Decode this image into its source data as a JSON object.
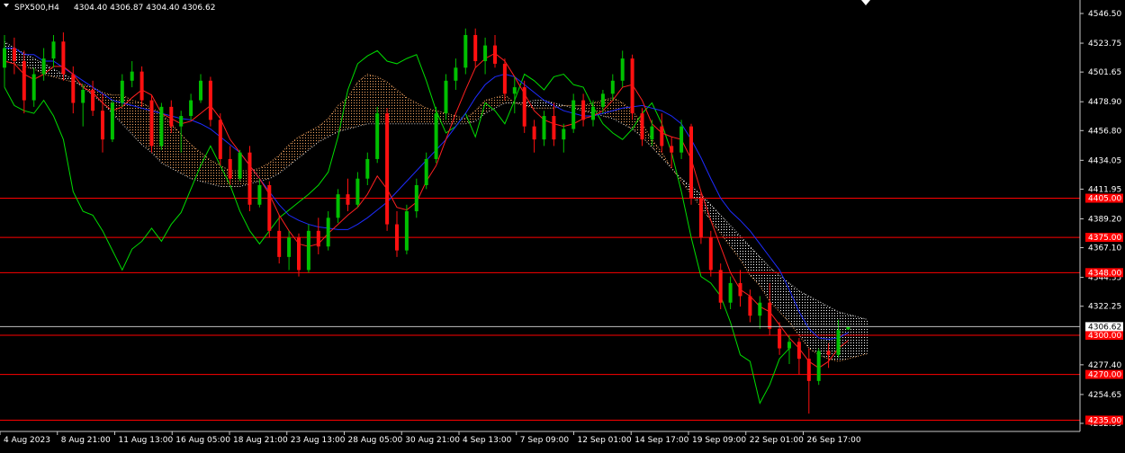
{
  "chart_data": {
    "type": "candlestick",
    "symbol_label": "SPX500,H4",
    "ohlc_label": "4304.40 4306.87 4304.40 4306.62",
    "current_price": 4306.62,
    "current_price_label": "4306.62",
    "y_ticks": [
      {
        "value": 4546.5,
        "label": "4546.50"
      },
      {
        "value": 4523.75,
        "label": "4523.75"
      },
      {
        "value": 4501.65,
        "label": "4501.65"
      },
      {
        "value": 4478.9,
        "label": "4478.90"
      },
      {
        "value": 4456.8,
        "label": "4456.80"
      },
      {
        "value": 4434.05,
        "label": "4434.05"
      },
      {
        "value": 4411.95,
        "label": "4411.95"
      },
      {
        "value": 4389.2,
        "label": "4389.20"
      },
      {
        "value": 4367.1,
        "label": "4367.10"
      },
      {
        "value": 4344.35,
        "label": "4344.35"
      },
      {
        "value": 4322.25,
        "label": "4322.25"
      },
      {
        "value": 4277.4,
        "label": "4277.40"
      },
      {
        "value": 4254.65,
        "label": "4254.65"
      },
      {
        "value": 4232.55,
        "label": "4232.55"
      }
    ],
    "x_ticks": [
      "4 Aug 2023",
      "8 Aug 21:00",
      "11 Aug 13:00",
      "16 Aug 05:00",
      "18 Aug 21:00",
      "23 Aug 13:00",
      "28 Aug 05:00",
      "30 Aug 21:00",
      "4 Sep 13:00",
      "7 Sep 09:00",
      "12 Sep 01:00",
      "14 Sep 17:00",
      "19 Sep 09:00",
      "22 Sep 01:00",
      "26 Sep 17:00"
    ],
    "levels": [
      {
        "value": 4405,
        "label": "4405.00"
      },
      {
        "value": 4375,
        "label": "4375.00"
      },
      {
        "value": 4348,
        "label": "4348.00"
      },
      {
        "value": 4300,
        "label": "4300.00"
      },
      {
        "value": 4270,
        "label": "4270.00"
      },
      {
        "value": 4235,
        "label": "4235.00"
      }
    ],
    "candles": [
      [
        4505,
        4530,
        4490,
        4520
      ],
      [
        4520,
        4528,
        4500,
        4510
      ],
      [
        4510,
        4518,
        4470,
        4480
      ],
      [
        4480,
        4505,
        4475,
        4500
      ],
      [
        4500,
        4520,
        4495,
        4512
      ],
      [
        4512,
        4530,
        4505,
        4525
      ],
      [
        4525,
        4532,
        4495,
        4500
      ],
      [
        4500,
        4506,
        4470,
        4478
      ],
      [
        4478,
        4492,
        4460,
        4488
      ],
      [
        4488,
        4495,
        4468,
        4472
      ],
      [
        4472,
        4485,
        4440,
        4450
      ],
      [
        4450,
        4480,
        4448,
        4478
      ],
      [
        4478,
        4500,
        4475,
        4495
      ],
      [
        4495,
        4510,
        4490,
        4502
      ],
      [
        4502,
        4506,
        4475,
        4480
      ],
      [
        4480,
        4484,
        4440,
        4445
      ],
      [
        4445,
        4478,
        4442,
        4475
      ],
      [
        4475,
        4480,
        4455,
        4460
      ],
      [
        4460,
        4472,
        4440,
        4468
      ],
      [
        4468,
        4485,
        4465,
        4480
      ],
      [
        4480,
        4500,
        4478,
        4495
      ],
      [
        4495,
        4498,
        4460,
        4465
      ],
      [
        4465,
        4470,
        4430,
        4435
      ],
      [
        4435,
        4445,
        4415,
        4420
      ],
      [
        4420,
        4442,
        4418,
        4440
      ],
      [
        4440,
        4445,
        4395,
        4400
      ],
      [
        4400,
        4420,
        4398,
        4415
      ],
      [
        4415,
        4418,
        4375,
        4380
      ],
      [
        4380,
        4392,
        4355,
        4360
      ],
      [
        4360,
        4380,
        4350,
        4375
      ],
      [
        4375,
        4378,
        4345,
        4350
      ],
      [
        4350,
        4385,
        4348,
        4380
      ],
      [
        4380,
        4390,
        4362,
        4368
      ],
      [
        4368,
        4395,
        4365,
        4390
      ],
      [
        4390,
        4412,
        4386,
        4408
      ],
      [
        4408,
        4420,
        4395,
        4400
      ],
      [
        4400,
        4425,
        4398,
        4420
      ],
      [
        4420,
        4440,
        4415,
        4435
      ],
      [
        4435,
        4475,
        4432,
        4470
      ],
      [
        4470,
        4474,
        4380,
        4385
      ],
      [
        4385,
        4395,
        4360,
        4365
      ],
      [
        4365,
        4400,
        4362,
        4395
      ],
      [
        4395,
        4420,
        4390,
        4415
      ],
      [
        4415,
        4440,
        4412,
        4435
      ],
      [
        4435,
        4475,
        4432,
        4470
      ],
      [
        4470,
        4500,
        4465,
        4495
      ],
      [
        4495,
        4512,
        4488,
        4505
      ],
      [
        4505,
        4535,
        4500,
        4530
      ],
      [
        4530,
        4535,
        4505,
        4510
      ],
      [
        4510,
        4528,
        4500,
        4522
      ],
      [
        4522,
        4530,
        4505,
        4508
      ],
      [
        4508,
        4512,
        4480,
        4485
      ],
      [
        4485,
        4498,
        4470,
        4490
      ],
      [
        4490,
        4495,
        4455,
        4460
      ],
      [
        4460,
        4465,
        4440,
        4450
      ],
      [
        4450,
        4472,
        4445,
        4468
      ],
      [
        4468,
        4478,
        4445,
        4450
      ],
      [
        4450,
        4462,
        4440,
        4458
      ],
      [
        4458,
        4485,
        4455,
        4480
      ],
      [
        4480,
        4485,
        4460,
        4465
      ],
      [
        4465,
        4480,
        4460,
        4475
      ],
      [
        4475,
        4488,
        4470,
        4485
      ],
      [
        4485,
        4500,
        4480,
        4495
      ],
      [
        4495,
        4518,
        4490,
        4512
      ],
      [
        4512,
        4515,
        4465,
        4470
      ],
      [
        4470,
        4474,
        4445,
        4450
      ],
      [
        4450,
        4465,
        4445,
        4460
      ],
      [
        4460,
        4470,
        4440,
        4445
      ],
      [
        4445,
        4452,
        4428,
        4440
      ],
      [
        4440,
        4465,
        4435,
        4460
      ],
      [
        4460,
        4462,
        4400,
        4405
      ],
      [
        4405,
        4410,
        4370,
        4375
      ],
      [
        4375,
        4380,
        4345,
        4350
      ],
      [
        4350,
        4355,
        4320,
        4325
      ],
      [
        4325,
        4345,
        4320,
        4340
      ],
      [
        4340,
        4350,
        4322,
        4330
      ],
      [
        4330,
        4335,
        4310,
        4315
      ],
      [
        4315,
        4330,
        4305,
        4325
      ],
      [
        4325,
        4340,
        4300,
        4305
      ],
      [
        4305,
        4310,
        4285,
        4290
      ],
      [
        4290,
        4300,
        4278,
        4295
      ],
      [
        4295,
        4298,
        4270,
        4282
      ],
      [
        4282,
        4290,
        4240,
        4265
      ],
      [
        4265,
        4290,
        4262,
        4288
      ],
      [
        4288,
        4294,
        4275,
        4285
      ],
      [
        4285,
        4312,
        4283,
        4304
      ],
      [
        4304.4,
        4306.87,
        4304.4,
        4306.62
      ]
    ],
    "tenkan": [
      4510,
      4508,
      4500,
      4496,
      4500,
      4506,
      4506,
      4500,
      4490,
      4486,
      4478,
      4472,
      4475,
      4482,
      4488,
      4484,
      4470,
      4466,
      4462,
      4464,
      4470,
      4476,
      4466,
      4450,
      4440,
      4430,
      4420,
      4408,
      4392,
      4380,
      4370,
      4368,
      4370,
      4378,
      4385,
      4392,
      4398,
      4408,
      4422,
      4412,
      4398,
      4396,
      4402,
      4418,
      4430,
      4450,
      4470,
      4488,
      4505,
      4512,
      4516,
      4510,
      4498,
      4485,
      4472,
      4465,
      4462,
      4460,
      4462,
      4466,
      4468,
      4472,
      4480,
      4490,
      4492,
      4480,
      4462,
      4455,
      4452,
      4450,
      4435,
      4410,
      4388,
      4368,
      4348,
      4335,
      4330,
      4322,
      4318,
      4308,
      4298,
      4290,
      4280,
      4275,
      4280,
      4290,
      4296
    ],
    "kijun": [
      4520,
      4520,
      4515,
      4515,
      4510,
      4510,
      4505,
      4500,
      4495,
      4490,
      4485,
      4480,
      4478,
      4476,
      4474,
      4472,
      4470,
      4468,
      4466,
      4465,
      4462,
      4458,
      4452,
      4446,
      4440,
      4430,
      4420,
      4410,
      4400,
      4392,
      4388,
      4385,
      4383,
      4382,
      4381,
      4381,
      4385,
      4390,
      4396,
      4402,
      4410,
      4418,
      4426,
      4434,
      4442,
      4450,
      4460,
      4470,
      4482,
      4492,
      4498,
      4500,
      4498,
      4492,
      4486,
      4480,
      4476,
      4472,
      4470,
      4468,
      4468,
      4470,
      4472,
      4474,
      4475,
      4476,
      4474,
      4472,
      4468,
      4462,
      4450,
      4436,
      4420,
      4405,
      4395,
      4388,
      4380,
      4370,
      4360,
      4350,
      4335,
      4318,
      4305,
      4298,
      4297,
      4298,
      4302
    ],
    "chikou": [
      4490,
      4476,
      4472,
      4470,
      4480,
      4468,
      4450,
      4410,
      4395,
      4392,
      4380,
      4365,
      4350,
      4366,
      4372,
      4382,
      4372,
      4385,
      4394,
      4412,
      4430,
      4445,
      4430,
      4415,
      4395,
      4380,
      4370,
      4380,
      4390,
      4396,
      4402,
      4408,
      4415,
      4425,
      4452,
      4488,
      4508,
      4514,
      4518,
      4510,
      4508,
      4512,
      4515,
      4495,
      4472,
      4455,
      4460,
      4470,
      4452,
      4478,
      4472,
      4462,
      4480,
      4500,
      4495,
      4488,
      4498,
      4500,
      4492,
      4490,
      4475,
      4462,
      4455,
      4450,
      4458,
      4470,
      4478,
      4462,
      4440,
      4410,
      4375,
      4345,
      4340,
      4330,
      4310,
      4285,
      4280,
      4248,
      4262,
      4282,
      4290
    ],
    "cloud_a": [
      4510,
      4508,
      4506,
      4504,
      4500,
      4498,
      4496,
      4494,
      4492,
      4490,
      4486,
      4484,
      4484,
      4480,
      4478,
      4474,
      4470,
      4462,
      4454,
      4446,
      4440,
      4434,
      4430,
      4426,
      4426,
      4426,
      4428,
      4432,
      4438,
      4446,
      4452,
      4456,
      4460,
      4466,
      4476,
      4482,
      4494,
      4500,
      4498,
      4494,
      4488,
      4482,
      4478,
      4474,
      4472,
      4470,
      4468,
      4466,
      4472,
      4480,
      4482,
      4484,
      4478,
      4476,
      4474,
      4474,
      4474,
      4476,
      4476,
      4476,
      4478,
      4480,
      4482,
      4478,
      4472,
      4462,
      4450,
      4440,
      4428,
      4418,
      4408,
      4398,
      4388,
      4378,
      4368,
      4358,
      4346,
      4338,
      4326,
      4318,
      4310,
      4300,
      4290,
      4285,
      4282,
      4280,
      4282,
      4284,
      4286
    ],
    "cloud_b": [
      4525,
      4520,
      4516,
      4512,
      4508,
      4504,
      4500,
      4496,
      4490,
      4484,
      4478,
      4470,
      4462,
      4454,
      4446,
      4440,
      4432,
      4428,
      4424,
      4420,
      4418,
      4416,
      4414,
      4414,
      4414,
      4416,
      4418,
      4420,
      4424,
      4430,
      4436,
      4442,
      4448,
      4452,
      4456,
      4458,
      4460,
      4462,
      4462,
      4462,
      4462,
      4462,
      4462,
      4462,
      4462,
      4462,
      4462,
      4462,
      4464,
      4470,
      4474,
      4478,
      4478,
      4478,
      4480,
      4480,
      4478,
      4476,
      4474,
      4472,
      4470,
      4468,
      4466,
      4462,
      4458,
      4452,
      4444,
      4436,
      4428,
      4420,
      4414,
      4408,
      4400,
      4392,
      4384,
      4376,
      4368,
      4360,
      4352,
      4346,
      4340,
      4334,
      4330,
      4326,
      4322,
      4318,
      4316,
      4314,
      4312
    ]
  }
}
